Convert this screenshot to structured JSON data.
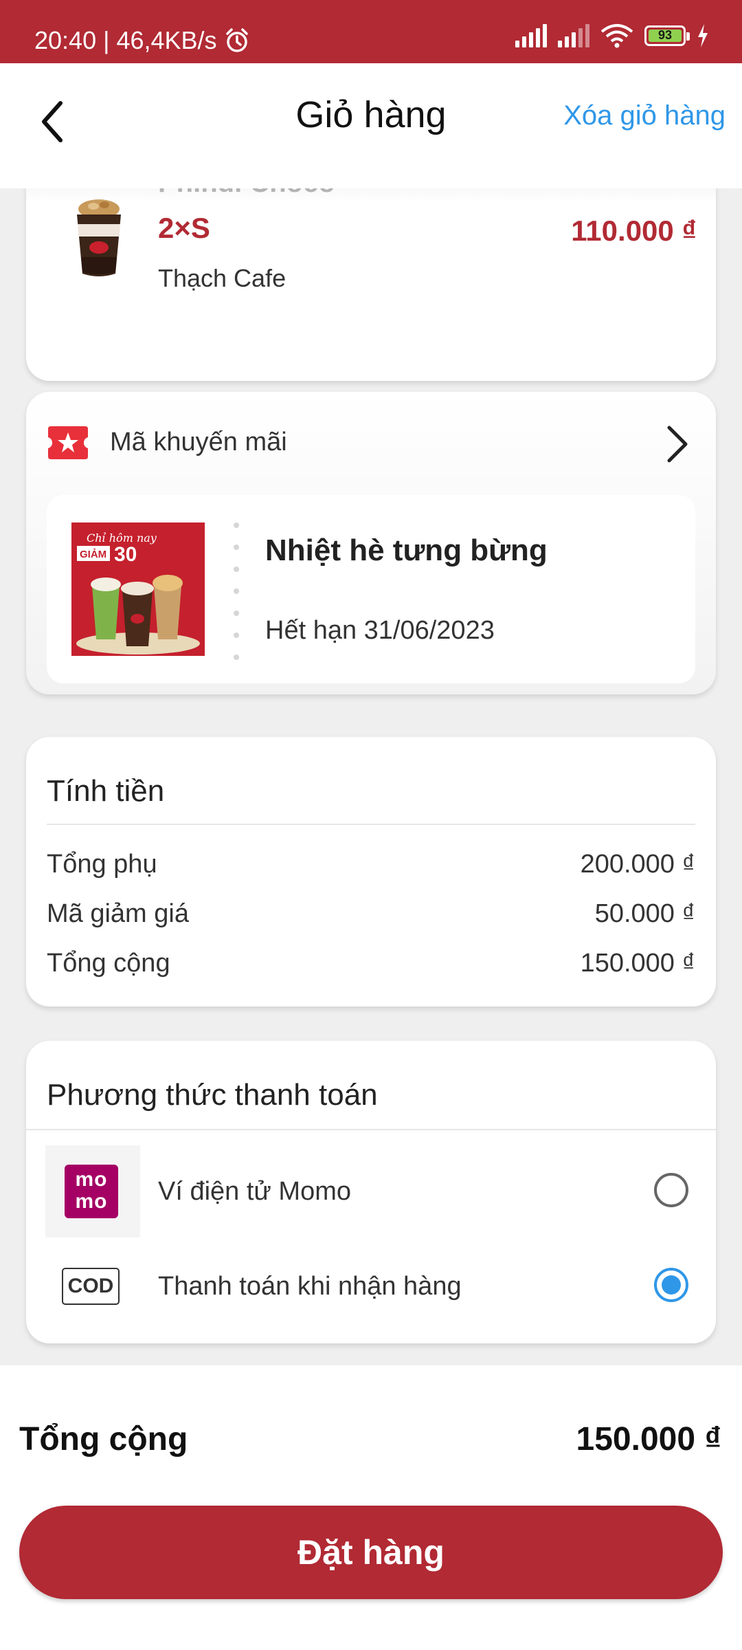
{
  "status_bar": {
    "time_speed": "20:40 | 46,4KB/s",
    "battery": "93"
  },
  "header": {
    "title": "Giỏ hàng",
    "clear_cart": "Xóa giỏ hàng"
  },
  "cart_item": {
    "name": "Phindi Choco",
    "size": "2×S",
    "price": "110.000 ₫",
    "topping": "Thạch Cafe"
  },
  "promo": {
    "label": "Mã khuyến mãi",
    "voucher_title": "Nhiệt hè tưng bừng",
    "voucher_expiry": "Hết hạn 31/06/2023",
    "voucher_image_text_top": "Chỉ hôm nay",
    "voucher_image_badge": "GIẢM",
    "voucher_image_percent": "30"
  },
  "bill": {
    "title": "Tính tiền",
    "rows": [
      {
        "label": "Tổng phụ",
        "value": "200.000 ₫"
      },
      {
        "label": "Mã giảm giá",
        "value": "50.000 ₫"
      },
      {
        "label": "Tổng cộng",
        "value": "150.000 ₫"
      }
    ]
  },
  "payment": {
    "title": "Phương thức thanh toán",
    "methods": [
      {
        "label": "Ví điện tử Momo",
        "logo": "mo\nmo",
        "selected": false
      },
      {
        "label": "Thanh toán khi nhận hàng",
        "logo": "COD",
        "selected": true
      }
    ]
  },
  "footer": {
    "total_label": "Tổng cộng",
    "total_value": "150.000 ₫",
    "order_button": "Đặt hàng"
  },
  "colors": {
    "brand": "#b12a34",
    "link": "#2f97e8",
    "momo": "#a50064"
  }
}
